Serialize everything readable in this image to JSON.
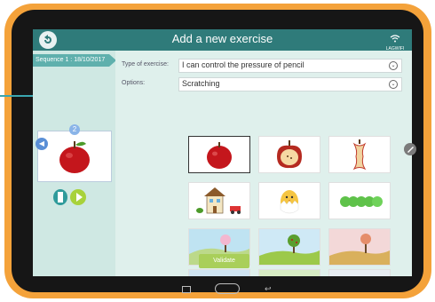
{
  "header": {
    "title": "Add a new exercise",
    "wifi_label": "LAGWIFI"
  },
  "sidebar": {
    "sequence_tab": "Sequence 1 : 18/10/2017",
    "thumb_badge": "2"
  },
  "form": {
    "type_label": "Type of exercise:",
    "type_value": "I can control the pressure of pencil",
    "options_label": "Options:",
    "options_value": "Scratching"
  },
  "buttons": {
    "validate": "Validate"
  },
  "images": [
    {
      "name": "apple-red"
    },
    {
      "name": "apple-cut"
    },
    {
      "name": "apple-core"
    },
    {
      "name": "house-and-car"
    },
    {
      "name": "chick-in-egg"
    },
    {
      "name": "green-caterpillar"
    },
    {
      "name": "tree-spring-landscape"
    },
    {
      "name": "tree-summer-landscape"
    },
    {
      "name": "tree-autumn-landscape"
    }
  ],
  "colors": {
    "topbar": "#2f7b7a",
    "accent_green": "#a9cf5a",
    "tablet_frame": "#f4a23a"
  }
}
